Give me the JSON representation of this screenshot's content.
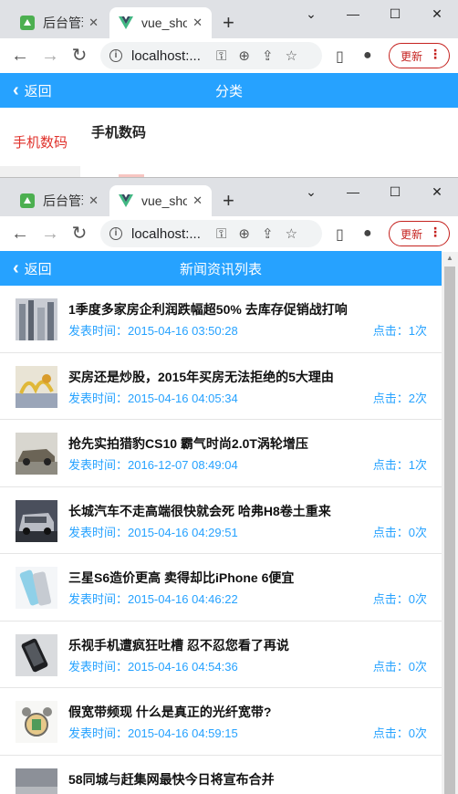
{
  "browser": {
    "tab_inactive_title": "后台管理",
    "tab_active_title": "vue_shop",
    "tab_close": "✕",
    "new_tab": "+",
    "url": "localhost:...",
    "update_label": "更新",
    "menu_dots": "⋮",
    "icons": [
      "minimize-icon",
      "maximize-icon",
      "close-icon",
      "chevron-down-icon",
      "back-icon",
      "forward-icon",
      "reload-icon",
      "info-icon",
      "key-icon",
      "zoom-icon",
      "share-icon",
      "star-icon",
      "sidebar-icon",
      "profile-icon"
    ]
  },
  "window1": {
    "appbar": {
      "back_label": "返回",
      "title": "分类"
    },
    "category": {
      "side_item": "手机数码",
      "content_title": "手机数码"
    }
  },
  "window2": {
    "appbar": {
      "back_label": "返回",
      "title": "新闻资讯列表"
    },
    "news": [
      {
        "title": "1季度多家房企利润跌幅超50% 去库存促销战打响",
        "time": "发表时间：2015-04-16 03:50:28",
        "clicks": "点击：1次"
      },
      {
        "title": "买房还是炒股，2015年买房无法拒绝的5大理由",
        "time": "发表时间：2015-04-16 04:05:34",
        "clicks": "点击：2次"
      },
      {
        "title": "抢先实拍猎豹CS10 霸气时尚2.0T涡轮增压",
        "time": "发表时间：2016-12-07 08:49:04",
        "clicks": "点击：1次"
      },
      {
        "title": "长城汽车不走高端很快就会死 哈弗H8卷土重来",
        "time": "发表时间：2015-04-16 04:29:51",
        "clicks": "点击：0次"
      },
      {
        "title": "三星S6造价更高 卖得却比iPhone 6便宜",
        "time": "发表时间：2015-04-16 04:46:22",
        "clicks": "点击：0次"
      },
      {
        "title": "乐视手机遭疯狂吐槽 忍不忍您看了再说",
        "time": "发表时间：2015-04-16 04:54:36",
        "clicks": "点击：0次"
      },
      {
        "title": "假宽带频现 什么是真正的光纤宽带?",
        "time": "发表时间：2015-04-16 04:59:15",
        "clicks": "点击：0次"
      },
      {
        "title": "58同城与赶集网最快今日将宣布合并",
        "time": "",
        "clicks": ""
      }
    ]
  },
  "colors": {
    "accent": "#26a2ff",
    "category_active": "#e0312b",
    "update": "#c5221f"
  }
}
